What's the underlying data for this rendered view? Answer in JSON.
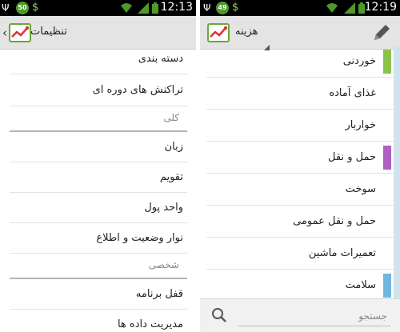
{
  "left": {
    "status": {
      "time": "12:13",
      "badge": "50"
    },
    "action_bar": {
      "title": "تنظیمات"
    },
    "settings": {
      "items_top": [
        "دسته بندی",
        "تراکنش های دوره ای"
      ],
      "header_general": "کلی",
      "items_general": [
        "زبان",
        "تقویم",
        "واحد پول",
        "نوار وضعیت و اطلاع"
      ],
      "header_personal": "شخصی",
      "items_personal": [
        "قفل برنامه",
        "مدیریت داده ها"
      ]
    }
  },
  "right": {
    "status": {
      "time": "12:19",
      "badge": "49"
    },
    "action_bar": {
      "title": "هزینه"
    },
    "categories": [
      {
        "label": "خوردنی",
        "color": "#8bc34a"
      },
      {
        "label": "غذای آماده",
        "color": ""
      },
      {
        "label": "خواربار",
        "color": ""
      },
      {
        "label": "حمل و نقل",
        "color": "#b05fc3"
      },
      {
        "label": "سوخت",
        "color": ""
      },
      {
        "label": "حمل و نقل عمومی",
        "color": ""
      },
      {
        "label": "تعمیرات ماشین",
        "color": ""
      },
      {
        "label": "سلامت",
        "color": "#6fb7e0"
      }
    ],
    "search": {
      "placeholder": "جستجو"
    }
  },
  "icons": {
    "logo": "app-logo-icon",
    "back": "chevron-left-icon",
    "edit": "pencil-icon",
    "search": "search-icon",
    "wifi": "wifi-icon",
    "signal": "signal-icon",
    "battery": "battery-icon"
  }
}
